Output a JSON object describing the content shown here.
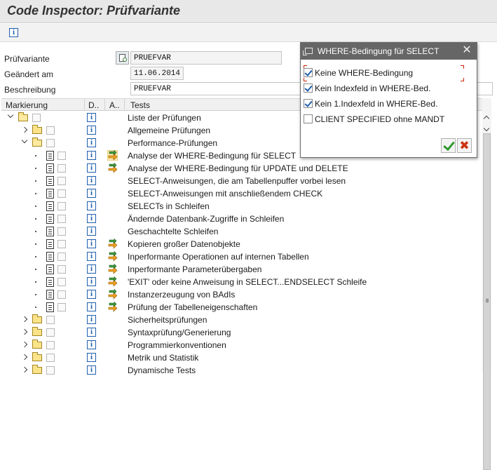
{
  "window": {
    "title": "Code Inspector: Prüfvariante"
  },
  "toolbar": {
    "info_icon": "info-icon"
  },
  "form": {
    "pruefvariante_label": "Prüfvariante",
    "pruefvariante_value": "PRUEFVAR",
    "geaendert_label": "Geändert am",
    "geaendert_value": "11.06.2014",
    "beschreibung_label": "Beschreibung",
    "beschreibung_value": "PRUEFVAR"
  },
  "tree": {
    "columns": {
      "markierung": "Markierung",
      "d": "D..",
      "a": "A..",
      "tests": "Tests"
    },
    "rows": [
      {
        "level": 0,
        "expand": "down",
        "icon": "folder-open",
        "info": true,
        "arrow": false,
        "text": "Liste der Prüfungen"
      },
      {
        "level": 1,
        "expand": "right",
        "icon": "folder",
        "info": true,
        "arrow": false,
        "text": "Allgemeine Prüfungen"
      },
      {
        "level": 1,
        "expand": "down",
        "icon": "folder-open",
        "info": true,
        "arrow": false,
        "text": "Performance-Prüfungen"
      },
      {
        "level": 2,
        "expand": "dot",
        "icon": "doc",
        "info": true,
        "arrow": true,
        "arrow_highlight": true,
        "text": "Analyse der WHERE-Bedingung für SELECT"
      },
      {
        "level": 2,
        "expand": "dot",
        "icon": "doc",
        "info": true,
        "arrow": true,
        "text": "Analyse der WHERE-Bedingung für  UPDATE und DELETE"
      },
      {
        "level": 2,
        "expand": "dot",
        "icon": "doc",
        "info": true,
        "arrow": false,
        "text": "SELECT-Anweisungen, die am Tabellenpuffer vorbei lesen"
      },
      {
        "level": 2,
        "expand": "dot",
        "icon": "doc",
        "info": true,
        "arrow": false,
        "text": "SELECT-Anweisungen mit anschließendem CHECK"
      },
      {
        "level": 2,
        "expand": "dot",
        "icon": "doc",
        "info": true,
        "arrow": false,
        "text": "SELECTs in Schleifen"
      },
      {
        "level": 2,
        "expand": "dot",
        "icon": "doc",
        "info": true,
        "arrow": false,
        "text": "Ändernde Datenbank-Zugriffe in Schleifen"
      },
      {
        "level": 2,
        "expand": "dot",
        "icon": "doc",
        "info": true,
        "arrow": false,
        "text": "Geschachtelte Schleifen"
      },
      {
        "level": 2,
        "expand": "dot",
        "icon": "doc",
        "info": true,
        "arrow": true,
        "text": "Kopieren großer Datenobjekte"
      },
      {
        "level": 2,
        "expand": "dot",
        "icon": "doc",
        "info": true,
        "arrow": true,
        "text": "Inperformante Operationen auf internen Tabellen"
      },
      {
        "level": 2,
        "expand": "dot",
        "icon": "doc",
        "info": true,
        "arrow": true,
        "text": "Inperformante Parameterübergaben"
      },
      {
        "level": 2,
        "expand": "dot",
        "icon": "doc",
        "info": true,
        "arrow": true,
        "text": "'EXIT' oder keine Anweisung in SELECT...ENDSELECT Schleife"
      },
      {
        "level": 2,
        "expand": "dot",
        "icon": "doc",
        "info": true,
        "arrow": true,
        "text": "Instanzerzeugung von BAdIs"
      },
      {
        "level": 2,
        "expand": "dot",
        "icon": "doc",
        "info": true,
        "arrow": true,
        "text": "Prüfung der Tabelleneigenschaften"
      },
      {
        "level": 1,
        "expand": "right",
        "icon": "folder",
        "info": true,
        "arrow": false,
        "text": "Sicherheitsprüfungen"
      },
      {
        "level": 1,
        "expand": "right",
        "icon": "folder",
        "info": true,
        "arrow": false,
        "text": "Syntaxprüfung/Generierung"
      },
      {
        "level": 1,
        "expand": "right",
        "icon": "folder",
        "info": true,
        "arrow": false,
        "text": "Programmierkonventionen"
      },
      {
        "level": 1,
        "expand": "right",
        "icon": "folder",
        "info": true,
        "arrow": false,
        "text": "Metrik und Statistik"
      },
      {
        "level": 1,
        "expand": "right",
        "icon": "folder",
        "info": true,
        "arrow": false,
        "text": "Dynamische Tests"
      }
    ]
  },
  "dialog": {
    "title": "WHERE-Bedingung für SELECT",
    "close": "✕",
    "options": [
      {
        "label": "Keine WHERE-Bedingung",
        "checked": true
      },
      {
        "label": "Kein Indexfeld in WHERE-Bed.",
        "checked": true
      },
      {
        "label": "Kein 1.Indexfeld in WHERE-Bed.",
        "checked": true
      },
      {
        "label": "CLIENT SPECIFIED ohne MANDT",
        "checked": false
      }
    ],
    "ok_icon": "check-icon",
    "cancel_icon": "cancel-icon",
    "cancel_glyph": "✖"
  },
  "colors": {
    "titlebar": "#e8e8e8",
    "dialog_titlebar": "#666666",
    "info_blue": "#1f5fae",
    "folder_yellow": "#fbe38a",
    "arrow_green": "#3d9a3d",
    "arrow_orange": "#f0a020",
    "focus_red": "#cc2200"
  }
}
